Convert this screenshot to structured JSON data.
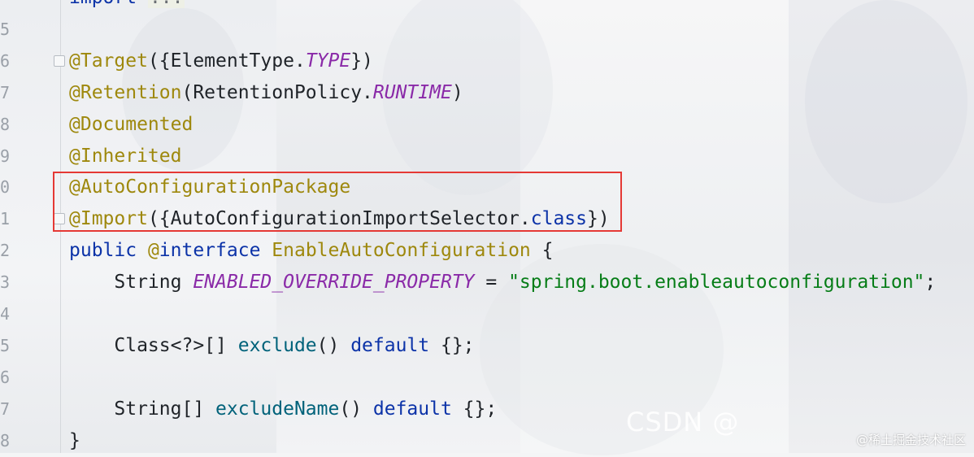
{
  "editor": {
    "lines": [
      {
        "num": "",
        "parts": [
          {
            "cls": "kw",
            "text": "import "
          },
          {
            "cls": "collapsed",
            "text": "..."
          }
        ]
      },
      {
        "num": "5",
        "parts": []
      },
      {
        "num": "6",
        "fold": true,
        "parts": [
          {
            "cls": "ann",
            "text": "@Target"
          },
          {
            "cls": "plain",
            "text": "({ElementType."
          },
          {
            "cls": "const",
            "text": "TYPE"
          },
          {
            "cls": "plain",
            "text": "})"
          }
        ]
      },
      {
        "num": "7",
        "parts": [
          {
            "cls": "ann",
            "text": "@Retention"
          },
          {
            "cls": "plain",
            "text": "(RetentionPolicy."
          },
          {
            "cls": "const",
            "text": "RUNTIME"
          },
          {
            "cls": "plain",
            "text": ")"
          }
        ]
      },
      {
        "num": "8",
        "parts": [
          {
            "cls": "ann",
            "text": "@Documented"
          }
        ]
      },
      {
        "num": "9",
        "parts": [
          {
            "cls": "ann",
            "text": "@Inherited"
          }
        ]
      },
      {
        "num": "0",
        "parts": [
          {
            "cls": "ann",
            "text": "@AutoConfigurationPackage"
          }
        ]
      },
      {
        "num": "1",
        "fold": true,
        "parts": [
          {
            "cls": "ann",
            "text": "@Import"
          },
          {
            "cls": "plain",
            "text": "({AutoConfigurationImportSelector."
          },
          {
            "cls": "kw",
            "text": "class"
          },
          {
            "cls": "plain",
            "text": "})"
          }
        ]
      },
      {
        "num": "2",
        "parts": [
          {
            "cls": "kw",
            "text": "public "
          },
          {
            "cls": "ann",
            "text": "@"
          },
          {
            "cls": "kw",
            "text": "interface "
          },
          {
            "cls": "ann",
            "text": "EnableAutoConfiguration"
          },
          {
            "cls": "plain",
            "text": " {"
          }
        ]
      },
      {
        "num": "3",
        "parts": [
          {
            "cls": "plain",
            "text": "    String "
          },
          {
            "cls": "const",
            "text": "ENABLED_OVERRIDE_PROPERTY"
          },
          {
            "cls": "plain",
            "text": " = "
          },
          {
            "cls": "str",
            "text": "\"spring.boot.enableautoconfiguration\""
          },
          {
            "cls": "plain",
            "text": ";"
          }
        ]
      },
      {
        "num": "4",
        "parts": []
      },
      {
        "num": "5",
        "parts": [
          {
            "cls": "plain",
            "text": "    Class<?>[] "
          },
          {
            "cls": "fn",
            "text": "exclude"
          },
          {
            "cls": "plain",
            "text": "() "
          },
          {
            "cls": "kw",
            "text": "default"
          },
          {
            "cls": "plain",
            "text": " {};"
          }
        ]
      },
      {
        "num": "6",
        "parts": []
      },
      {
        "num": "7",
        "parts": [
          {
            "cls": "plain",
            "text": "    String[] "
          },
          {
            "cls": "fn",
            "text": "excludeName"
          },
          {
            "cls": "plain",
            "text": "() "
          },
          {
            "cls": "kw",
            "text": "default"
          },
          {
            "cls": "plain",
            "text": " {};"
          }
        ]
      },
      {
        "num": "8",
        "parts": [
          {
            "cls": "plain",
            "text": "}"
          }
        ]
      }
    ]
  },
  "watermark": {
    "csdn": "CSDN @",
    "juejin": "@稀土掘金技术社区"
  },
  "colors": {
    "annotation": "#9e880d",
    "keyword": "#0c33a8",
    "constant": "#8a2aa8",
    "string": "#067d17",
    "method": "#00627a",
    "highlight_box": "#e53935"
  }
}
